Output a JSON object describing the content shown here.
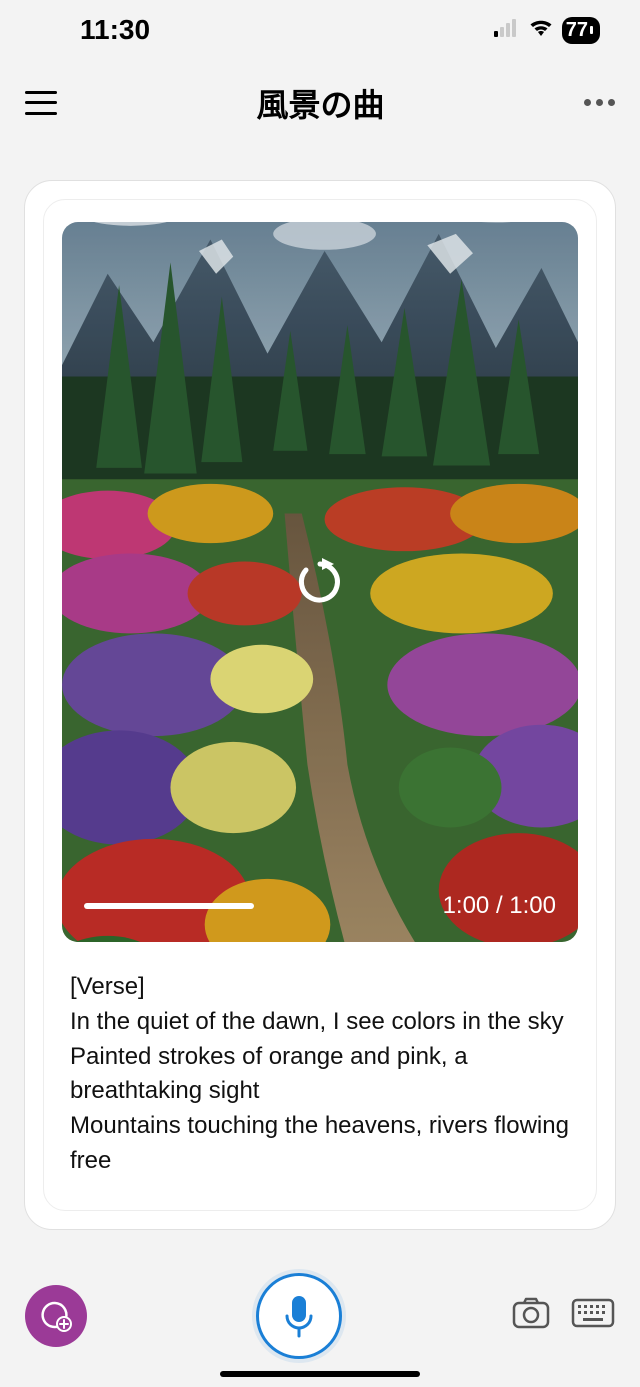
{
  "status": {
    "time": "11:30",
    "battery": "77"
  },
  "header": {
    "title": "風景の曲"
  },
  "media": {
    "time_display": "1:00 / 1:00"
  },
  "lyrics": {
    "tag": "[Verse]",
    "line1": "In the quiet of the dawn, I see colors in the sky",
    "line2": "Painted strokes of orange and pink, a breathtaking sight",
    "line3": "Mountains touching the heavens, rivers flowing free"
  }
}
